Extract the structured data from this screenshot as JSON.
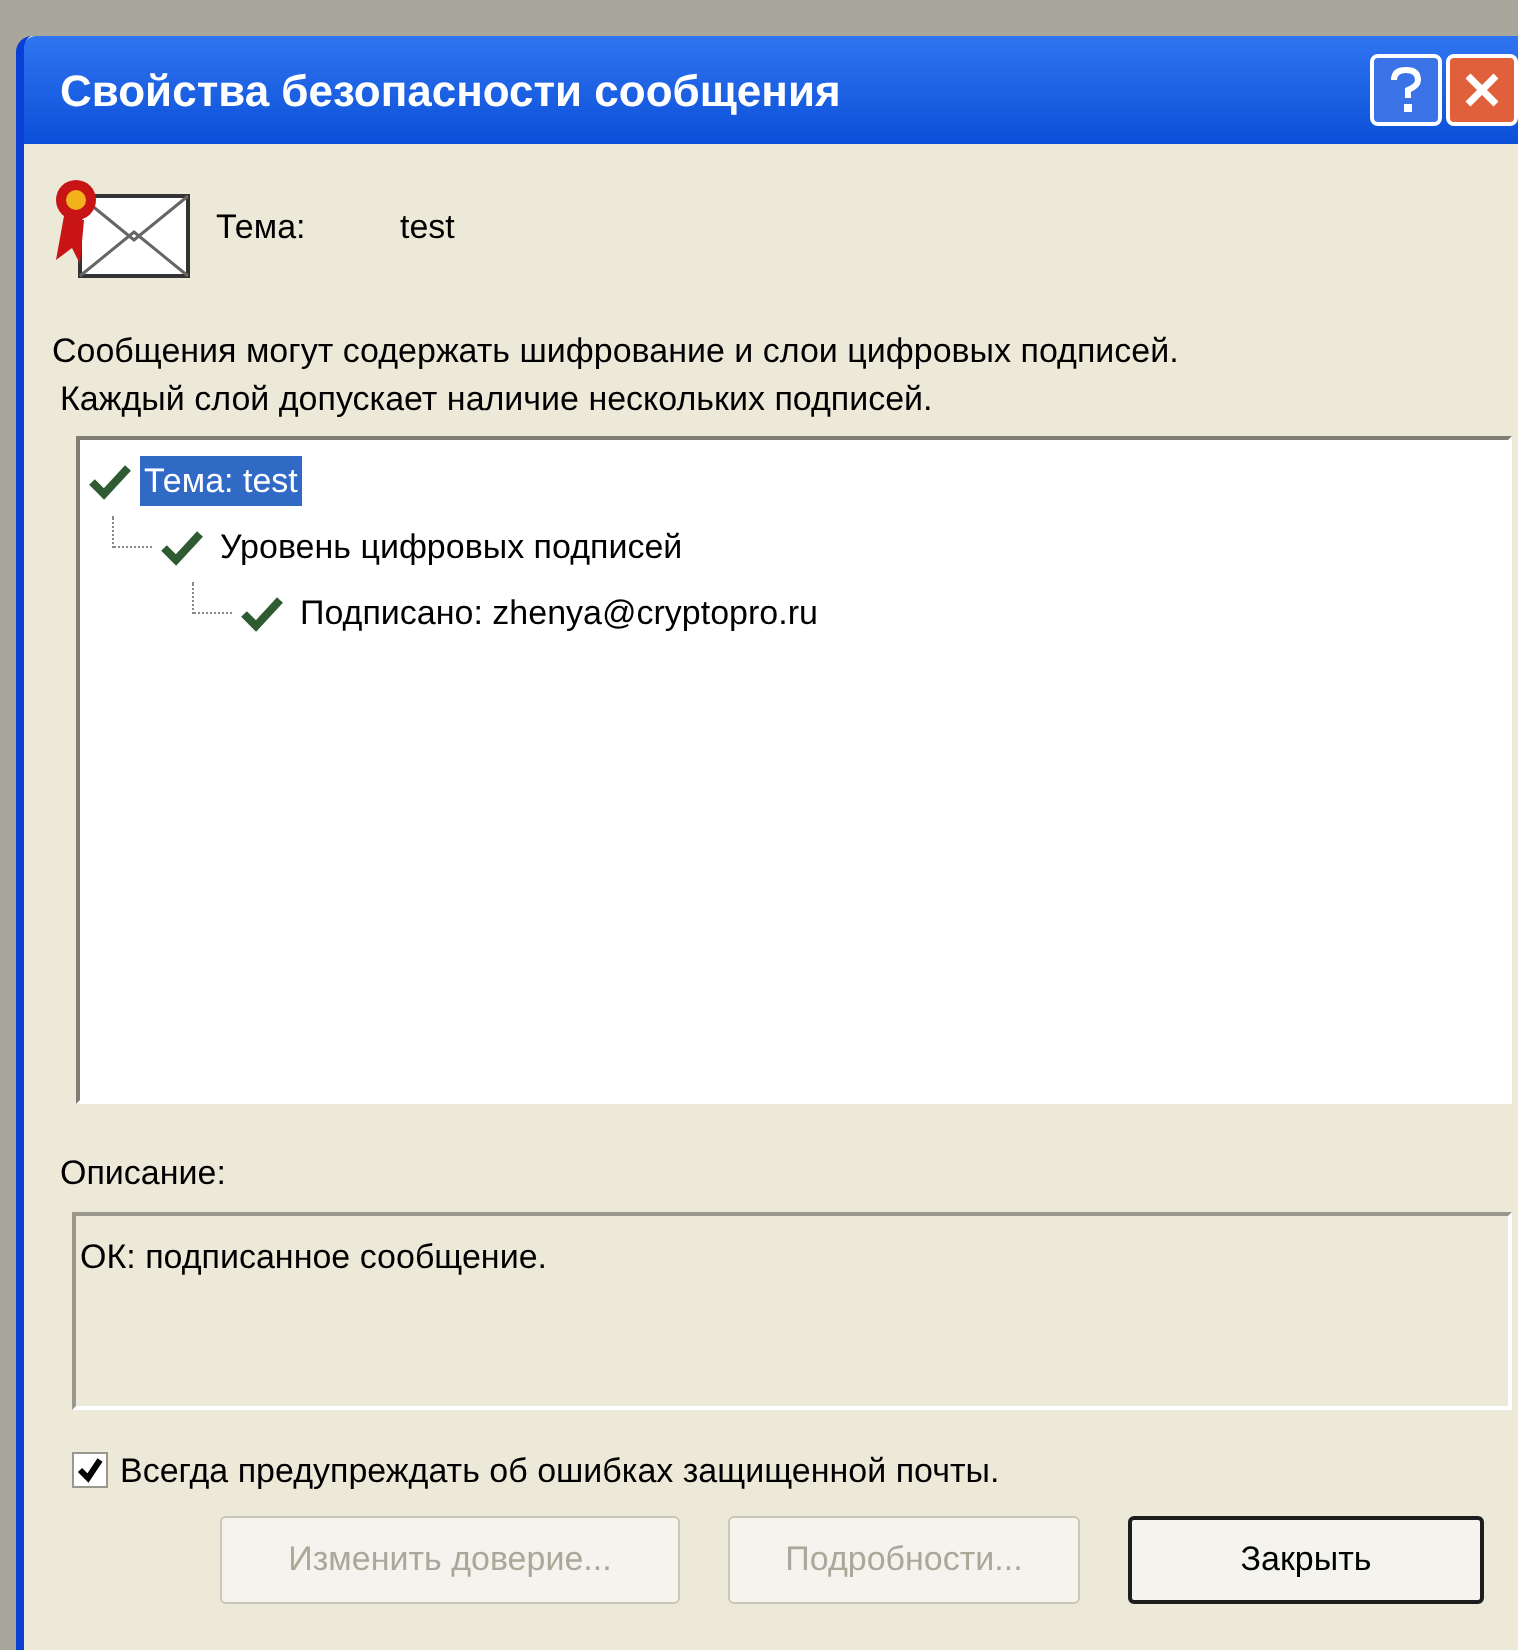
{
  "window": {
    "title": "Свойства безопасности сообщения"
  },
  "subject": {
    "label": "Тема:",
    "value": "test"
  },
  "intro": [
    "Сообщения могут содержать шифрование и слои цифровых подписей.",
    "Каждый слой допускает наличие нескольких подписей."
  ],
  "tree": [
    {
      "label": "Тема: test",
      "selected": true,
      "children": [
        {
          "label": "Уровень цифровых подписей",
          "selected": false,
          "children": [
            {
              "label": "Подписано: zhenya@cryptopro.ru",
              "selected": false
            }
          ]
        }
      ]
    }
  ],
  "description": {
    "label": "Описание:",
    "value": "ОК: подписанное сообщение."
  },
  "warn_checkbox": {
    "label": "Всегда предупреждать об ошибках защищенной почты.",
    "checked": true
  },
  "buttons": [
    {
      "label": "Изменить доверие...",
      "disabled": true
    },
    {
      "label": "Подробности...",
      "disabled": true
    },
    {
      "label": "Закрыть",
      "disabled": false
    }
  ]
}
